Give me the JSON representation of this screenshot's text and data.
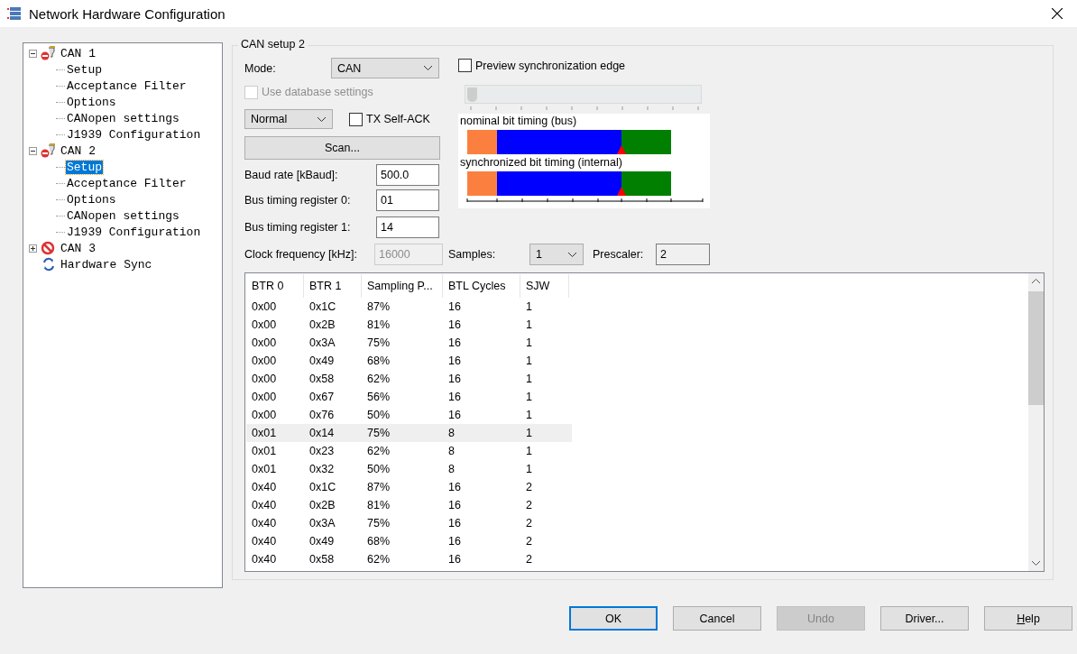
{
  "window": {
    "title": "Network Hardware Configuration"
  },
  "tree": [
    {
      "label": "CAN 1",
      "kind": "connector",
      "expanded": true,
      "selected": false,
      "children": [
        {
          "label": "Setup",
          "selected": false
        },
        {
          "label": "Acceptance Filter",
          "selected": false
        },
        {
          "label": "Options",
          "selected": false
        },
        {
          "label": "CANopen settings",
          "selected": false
        },
        {
          "label": "J1939 Configuration",
          "selected": false
        }
      ]
    },
    {
      "label": "CAN 2",
      "kind": "connector",
      "expanded": true,
      "selected": false,
      "children": [
        {
          "label": "Setup",
          "selected": true
        },
        {
          "label": "Acceptance Filter",
          "selected": false
        },
        {
          "label": "Options",
          "selected": false
        },
        {
          "label": "CANopen settings",
          "selected": false
        },
        {
          "label": "J1939 Configuration",
          "selected": false
        }
      ]
    },
    {
      "label": "CAN 3",
      "kind": "blocked",
      "expanded": false,
      "selected": false
    },
    {
      "label": "Hardware Sync",
      "kind": "sync",
      "selected": false
    }
  ],
  "setup": {
    "title": "CAN setup 2",
    "mode": {
      "label": "Mode:",
      "value": "CAN"
    },
    "use_database": {
      "label": "Use database settings",
      "checked": false,
      "disabled": true
    },
    "operating_mode": {
      "value": "Normal"
    },
    "tx_self_ack": {
      "label": "TX Self-ACK",
      "checked": false
    },
    "scan_button": "Scan...",
    "fields": [
      {
        "label": "Baud rate [kBaud]:",
        "value": "500.0"
      },
      {
        "label": "Bus timing register 0:",
        "value": "01"
      },
      {
        "label": "Bus timing register 1:",
        "value": "14"
      }
    ],
    "clock": {
      "label": "Clock frequency [kHz]:",
      "value": "16000",
      "disabled": true
    },
    "samples": {
      "label": "Samples:",
      "value": "1"
    },
    "prescaler": {
      "label": "Prescaler:",
      "value": "2"
    },
    "preview": {
      "label": "Preview synchronization edge",
      "checked": false,
      "level": 0
    },
    "timing_rows": [
      {
        "label": "nominal bit timing (bus)"
      },
      {
        "label": "synchronized bit timing (internal)"
      }
    ]
  },
  "table": {
    "columns": [
      "BTR 0",
      "BTR 1",
      "Sampling P...",
      "BTL Cycles",
      "SJW"
    ],
    "rows": [
      {
        "cells": [
          "0x00",
          "0x1C",
          "87%",
          "16",
          "1"
        ],
        "selected": false
      },
      {
        "cells": [
          "0x00",
          "0x2B",
          "81%",
          "16",
          "1"
        ],
        "selected": false
      },
      {
        "cells": [
          "0x00",
          "0x3A",
          "75%",
          "16",
          "1"
        ],
        "selected": false
      },
      {
        "cells": [
          "0x00",
          "0x49",
          "68%",
          "16",
          "1"
        ],
        "selected": false
      },
      {
        "cells": [
          "0x00",
          "0x58",
          "62%",
          "16",
          "1"
        ],
        "selected": false
      },
      {
        "cells": [
          "0x00",
          "0x67",
          "56%",
          "16",
          "1"
        ],
        "selected": false
      },
      {
        "cells": [
          "0x00",
          "0x76",
          "50%",
          "16",
          "1"
        ],
        "selected": false
      },
      {
        "cells": [
          "0x01",
          "0x14",
          "75%",
          "8",
          "1"
        ],
        "selected": true
      },
      {
        "cells": [
          "0x01",
          "0x23",
          "62%",
          "8",
          "1"
        ],
        "selected": false
      },
      {
        "cells": [
          "0x01",
          "0x32",
          "50%",
          "8",
          "1"
        ],
        "selected": false
      },
      {
        "cells": [
          "0x40",
          "0x1C",
          "87%",
          "16",
          "2"
        ],
        "selected": false
      },
      {
        "cells": [
          "0x40",
          "0x2B",
          "81%",
          "16",
          "2"
        ],
        "selected": false
      },
      {
        "cells": [
          "0x40",
          "0x3A",
          "75%",
          "16",
          "2"
        ],
        "selected": false
      },
      {
        "cells": [
          "0x40",
          "0x49",
          "68%",
          "16",
          "2"
        ],
        "selected": false
      },
      {
        "cells": [
          "0x40",
          "0x58",
          "62%",
          "16",
          "2"
        ],
        "selected": false
      }
    ]
  },
  "buttons": [
    {
      "label": "OK",
      "default": true,
      "disabled": false
    },
    {
      "label": "Cancel",
      "default": false,
      "disabled": false
    },
    {
      "label": "Undo",
      "default": false,
      "disabled": true
    },
    {
      "label": "Driver...",
      "default": false,
      "disabled": false
    },
    {
      "label": "Help",
      "default": false,
      "disabled": false
    }
  ]
}
